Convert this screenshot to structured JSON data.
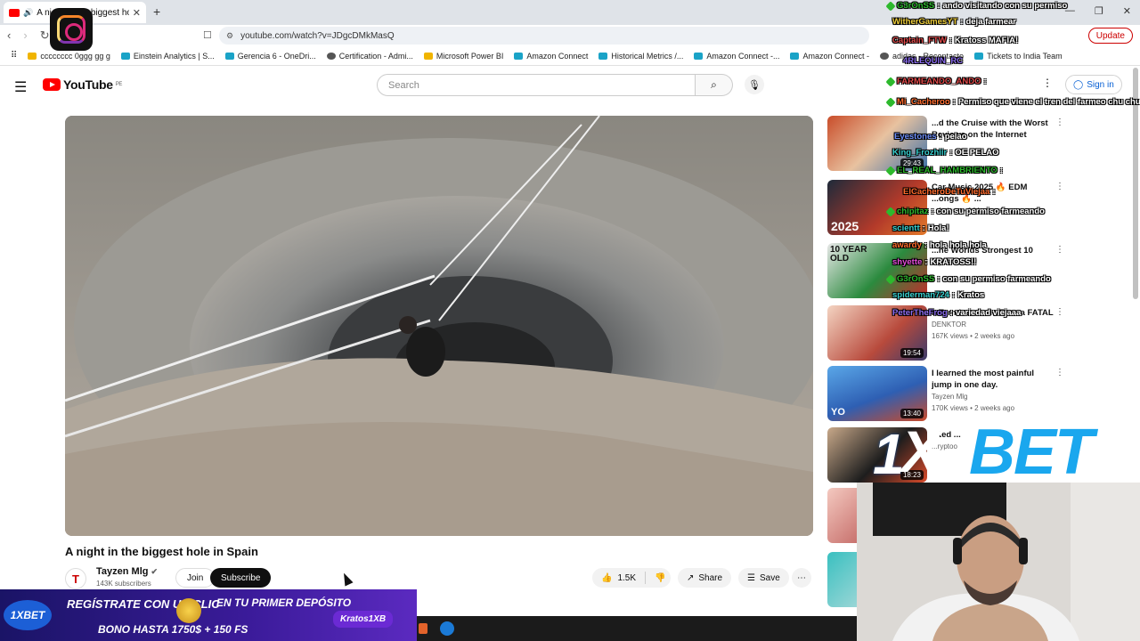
{
  "browser": {
    "tab_title": "A night in the biggest hole in",
    "url": "youtube.com/watch?v=JDgcDMkMasQ",
    "update_label": "Update",
    "bookmarks": [
      "cccccccc 0ggg gg g",
      "Einstein Analytics | S...",
      "Gerencia 6 - OneDri...",
      "Certification - Admi...",
      "Microsoft Power BI",
      "Amazon Connect",
      "Historical Metrics /...",
      "Amazon Connect -...",
      "Amazon Connect -",
      "adidas - Recontacto",
      "Tickets to India Team"
    ]
  },
  "youtube": {
    "logo_text": "YouTube",
    "logo_region": "PE",
    "search_placeholder": "Search",
    "signin_label": "Sign in"
  },
  "video": {
    "title": "A night in the biggest hole in Spain",
    "channel_name": "Tayzen Mlg",
    "channel_initial": "T",
    "subscribers": "143K subscribers",
    "join_label": "Join",
    "subscribe_label": "Subscribe",
    "likes": "1.5K",
    "share_label": "Share",
    "save_label": "Save"
  },
  "suggestions": [
    {
      "title": "...d the Cruise with the Worst Reviews on the Internet",
      "channel": "",
      "views": "",
      "duration": "29:43"
    },
    {
      "title": "Car Music 2025 🔥 EDM ...ongs 🔥 ...",
      "channel": "",
      "views": "...4 views • 14 hours ago",
      "duration": ""
    },
    {
      "title": "...he Worlds Strongest 10",
      "channel": "",
      "views": "...go",
      "duration": ""
    },
    {
      "title": "...Terminaron de Forma FATAL",
      "channel": "DENKTOR",
      "views": "167K views • 2 weeks ago",
      "duration": "19:54"
    },
    {
      "title": "I learned the most painful jump in one day.",
      "channel": "Tayzen Mlg",
      "views": "170K views • 2 weeks ago",
      "duration": "13:40"
    },
    {
      "title": "...ted ...",
      "channel": "...ryptoo",
      "views": "",
      "duration": "18:23"
    }
  ],
  "chat": [
    {
      "user": "G3rOnSS",
      "text": "ando visitando con su permiso",
      "color": "#2db92d"
    },
    {
      "user": "WitherGamesYT",
      "text": "deja farmear",
      "color": "#f2d13b"
    },
    {
      "user": "Captain_FTW",
      "text": "Kratoss MAFIA!",
      "color": "#e24b4b"
    },
    {
      "user": "4RLEQUIN_RC",
      "text": "",
      "color": "#8b6cf0"
    },
    {
      "user": "FARMEANDO_ANDO",
      "text": "",
      "color": "#e24b4b"
    },
    {
      "user": "Mi_Cacheroo",
      "text": "Permiso que viene el tren del farmeo chu chu",
      "color": "#ff6a2b"
    },
    {
      "user": "Eyestones",
      "text": "pelao",
      "color": "#6c8df7"
    },
    {
      "user": "King_Frozhiir",
      "text": "OE PELAO",
      "color": "#38d0d0"
    },
    {
      "user": "EL_REAL_HAMBRIENTO",
      "text": "",
      "color": "#2db92d"
    },
    {
      "user": "ElCacheroDeTuViejaa",
      "text": "",
      "color": "#ff6a2b"
    },
    {
      "user": "chipitaz",
      "text": "con su permiso farmeando",
      "color": "#2db92d"
    },
    {
      "user": "scientt",
      "text": "Hola!",
      "color": "#38d0d0"
    },
    {
      "user": "awardy",
      "text": "hola hola hola",
      "color": "#ff6a2b"
    },
    {
      "user": "shyette",
      "text": "KRATOSS!!",
      "color": "#e24bd8"
    },
    {
      "user": "G3rOnSS",
      "text": "con su permiso farmeando",
      "color": "#2db92d"
    },
    {
      "user": "spiderman724",
      "text": "Kratos",
      "color": "#38d0d0"
    },
    {
      "user": "PeterTheFrog",
      "text": "variedad viejaaa",
      "color": "#8b6cf0"
    }
  ],
  "ads": {
    "bet_logo": {
      "one": "1",
      "x": "X",
      "bet": "BET"
    },
    "banner": {
      "brand": "1XBET",
      "line1": "REGÍSTRATE CON UN CLIC",
      "line2": "EN TU PRIMER DEPÓSITO",
      "line3": "BONO HASTA 1750$ + 150 FS",
      "tag": "Kratos1XB"
    }
  }
}
